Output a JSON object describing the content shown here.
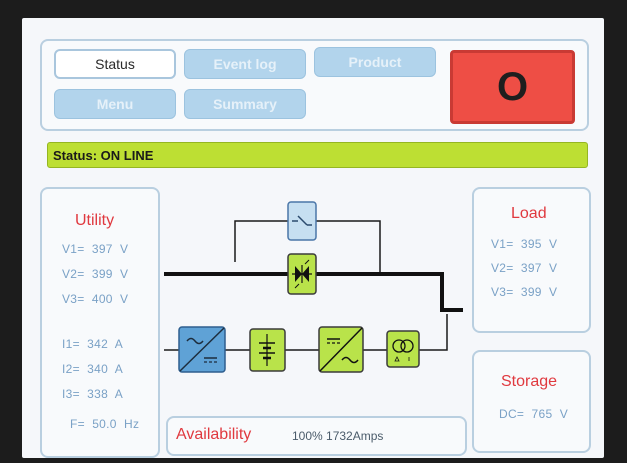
{
  "tabs": {
    "status": "Status",
    "event_log": "Event log",
    "product": "Product",
    "menu": "Menu",
    "summary": "Summary"
  },
  "alarm": {
    "symbol": "O",
    "color": "#ee4e45"
  },
  "status": {
    "text": "Status: ON LINE",
    "color": "#bddf33"
  },
  "utility": {
    "title": "Utility",
    "v1": "V1=  397  V",
    "v2": "V2=  399  V",
    "v3": "V3=  400  V",
    "i1": "I1=  342  A",
    "i2": "I2=  340  A",
    "i3": "I3=  338  A",
    "f": "F=  50.0  Hz"
  },
  "load": {
    "title": "Load",
    "v1": "V1=  395  V",
    "v2": "V2=  397  V",
    "v3": "V3=  399  V"
  },
  "storage": {
    "title": "Storage",
    "dc": "DC=  765  V"
  },
  "availability": {
    "label": "Availability",
    "value": "100%  1732Amps"
  },
  "diagram": {
    "bypass_switch": "switch-icon",
    "static_switch": "thyristor-icon",
    "rectifier": "ac-dc-converter-icon",
    "battery": "battery-icon",
    "inverter": "dc-ac-converter-icon",
    "transformer": "transformer-icon",
    "active_color": "#b9e34a",
    "inactive_color": "#c6dff1"
  }
}
